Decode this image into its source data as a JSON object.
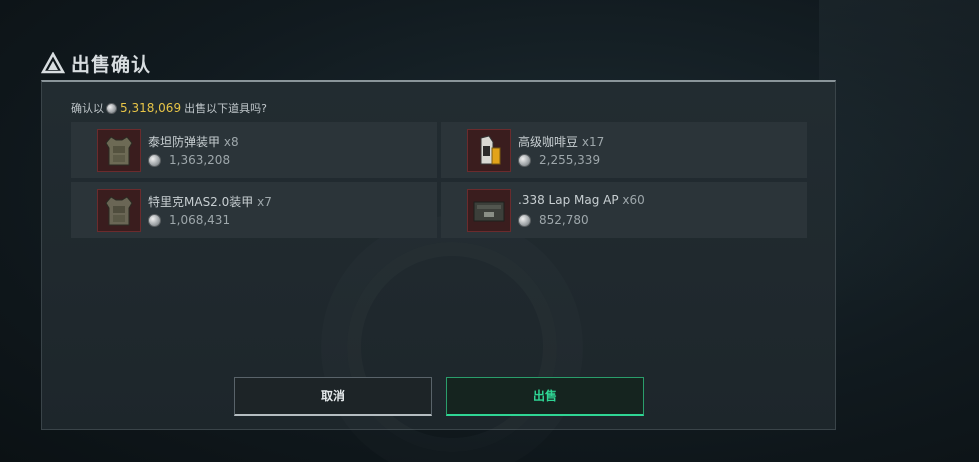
{
  "dialog": {
    "title": "出售确认",
    "prompt_prefix": "确认以",
    "total_amount": "5,318,069",
    "prompt_suffix": "出售以下道具吗?"
  },
  "items": [
    {
      "name": "泰坦防弹装甲",
      "qty": "x8",
      "price": "1,363,208",
      "icon": "body-armor-icon"
    },
    {
      "name": "高级咖啡豆",
      "qty": "x17",
      "price": "2,255,339",
      "icon": "coffee-bag-icon"
    },
    {
      "name": "特里克MAS2.0装甲",
      "qty": "x7",
      "price": "1,068,431",
      "icon": "body-armor-icon"
    },
    {
      "name": ".338 Lap Mag AP",
      "qty": "x60",
      "price": "852,780",
      "icon": "ammo-box-icon"
    }
  ],
  "buttons": {
    "cancel": "取消",
    "sell": "出售"
  },
  "colors": {
    "amount": "#e8c547",
    "sell_accent": "#2fd594",
    "item_thumb_bg": "#3a1d1e"
  }
}
